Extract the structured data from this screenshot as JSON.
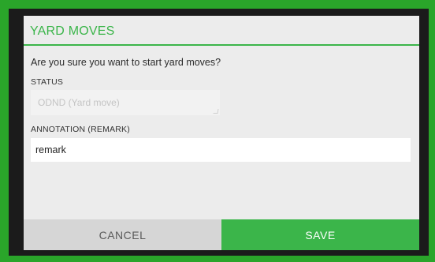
{
  "dialog": {
    "title": "YARD MOVES",
    "question": "Are you sure you want to start yard moves?",
    "status_label": "STATUS",
    "status_value": "ODND (Yard move)",
    "annotation_label": "ANNOTATION (REMARK)",
    "annotation_value": "remark",
    "cancel_label": "CANCEL",
    "save_label": "SAVE"
  },
  "colors": {
    "accent": "#3bb54a",
    "frame": "#2aa52a",
    "backdrop": "#1b1b1b",
    "dialog_bg": "#ececec",
    "cancel_bg": "#d6d6d6"
  }
}
